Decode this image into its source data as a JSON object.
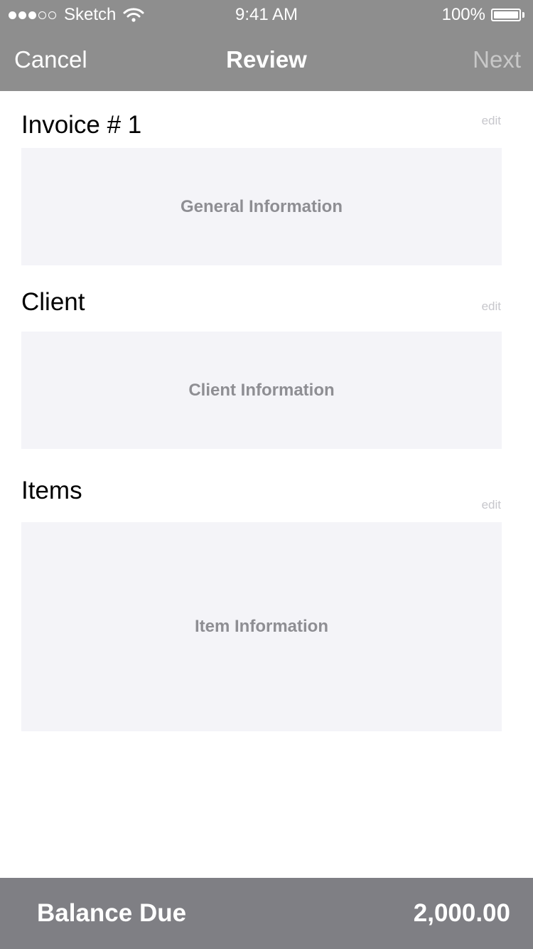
{
  "status_bar": {
    "signal_dots": [
      true,
      true,
      true,
      false,
      false
    ],
    "carrier": "Sketch",
    "time": "9:41 AM",
    "battery": "100%",
    "battery_level": 1.0
  },
  "nav": {
    "cancel_label": "Cancel",
    "title": "Review",
    "next_label": "Next"
  },
  "sections": {
    "invoice": {
      "title": "Invoice # 1",
      "edit_label": "edit",
      "placeholder": "General Information"
    },
    "client": {
      "title": "Client",
      "edit_label": "edit",
      "placeholder": "Client Information"
    },
    "items": {
      "title": "Items",
      "edit_label": "edit",
      "placeholder": "Item Information"
    }
  },
  "footer": {
    "label": "Balance Due",
    "value": "2,000.00"
  },
  "colors": {
    "header_bg": "#8e8e8e",
    "footer_bg": "#7f7f84",
    "card_bg": "#f4f4f8",
    "disabled_text": "#c8c8c8"
  }
}
